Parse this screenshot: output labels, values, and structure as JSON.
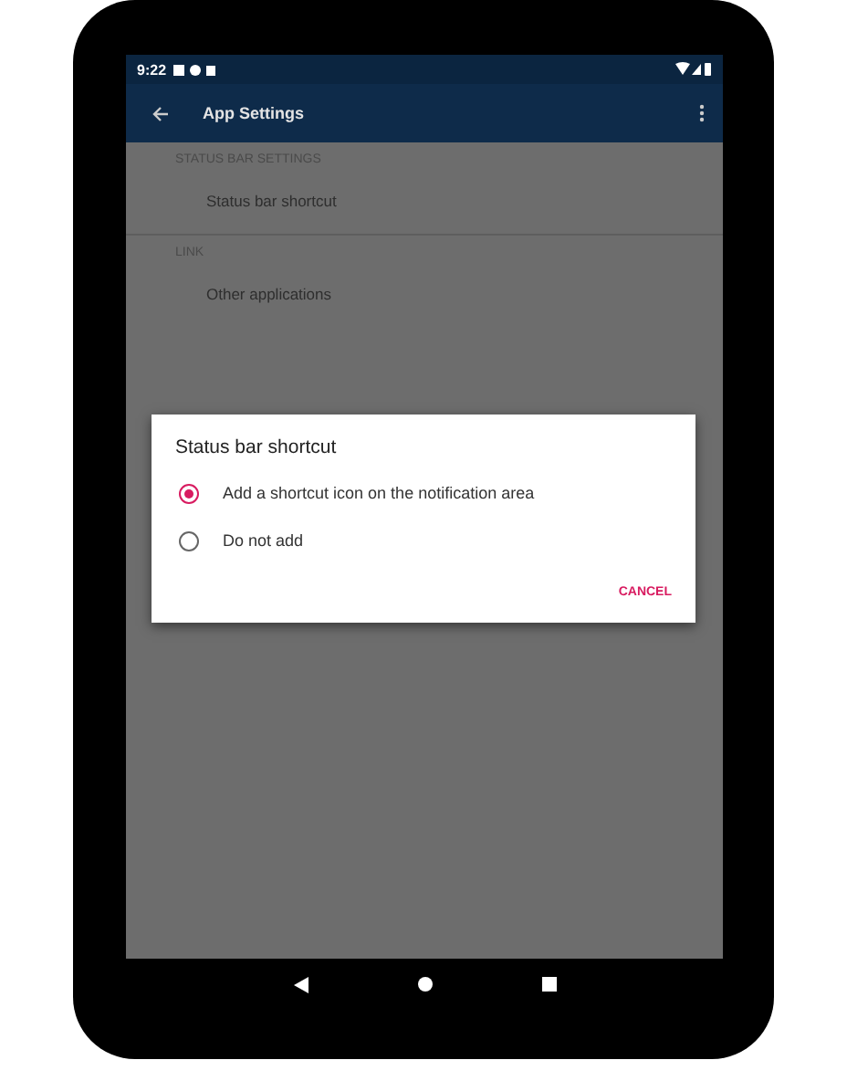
{
  "status_bar": {
    "time": "9:22"
  },
  "app_bar": {
    "title": "App Settings"
  },
  "sections": [
    {
      "header": "STATUS BAR SETTINGS",
      "items": [
        "Status bar shortcut"
      ]
    },
    {
      "header": "LINK",
      "items": [
        "Other applications"
      ]
    }
  ],
  "dialog": {
    "title": "Status bar shortcut",
    "options": [
      {
        "label": "Add a shortcut icon on the notification area",
        "selected": true
      },
      {
        "label": "Do not add",
        "selected": false
      }
    ],
    "buttons": [
      "CANCEL"
    ]
  }
}
